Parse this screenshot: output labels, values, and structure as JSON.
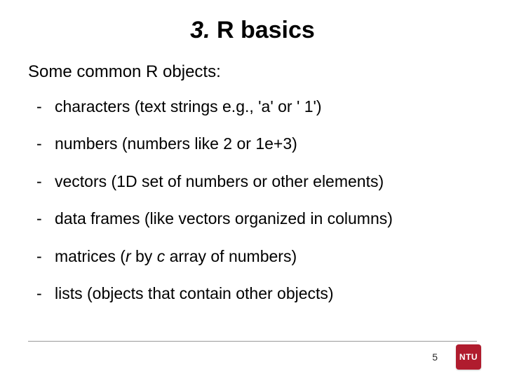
{
  "title": {
    "number": "3.",
    "text": " R basics"
  },
  "subtitle": "Some common R objects:",
  "items": [
    {
      "text": "characters (text strings e.g., 'a' or ' 1')"
    },
    {
      "text": "numbers (numbers like 2 or 1e+3)"
    },
    {
      "text": "vectors (1D set of numbers or other elements)"
    },
    {
      "text": "data frames (like vectors organized in columns)"
    },
    {
      "prefix": "matrices (",
      "ital1": "r",
      "mid": " by ",
      "ital2": "c",
      "suffix": " array of numbers)"
    },
    {
      "text": "lists (objects that contain other objects)"
    }
  ],
  "page_number": "5",
  "logo_text": "NTU"
}
